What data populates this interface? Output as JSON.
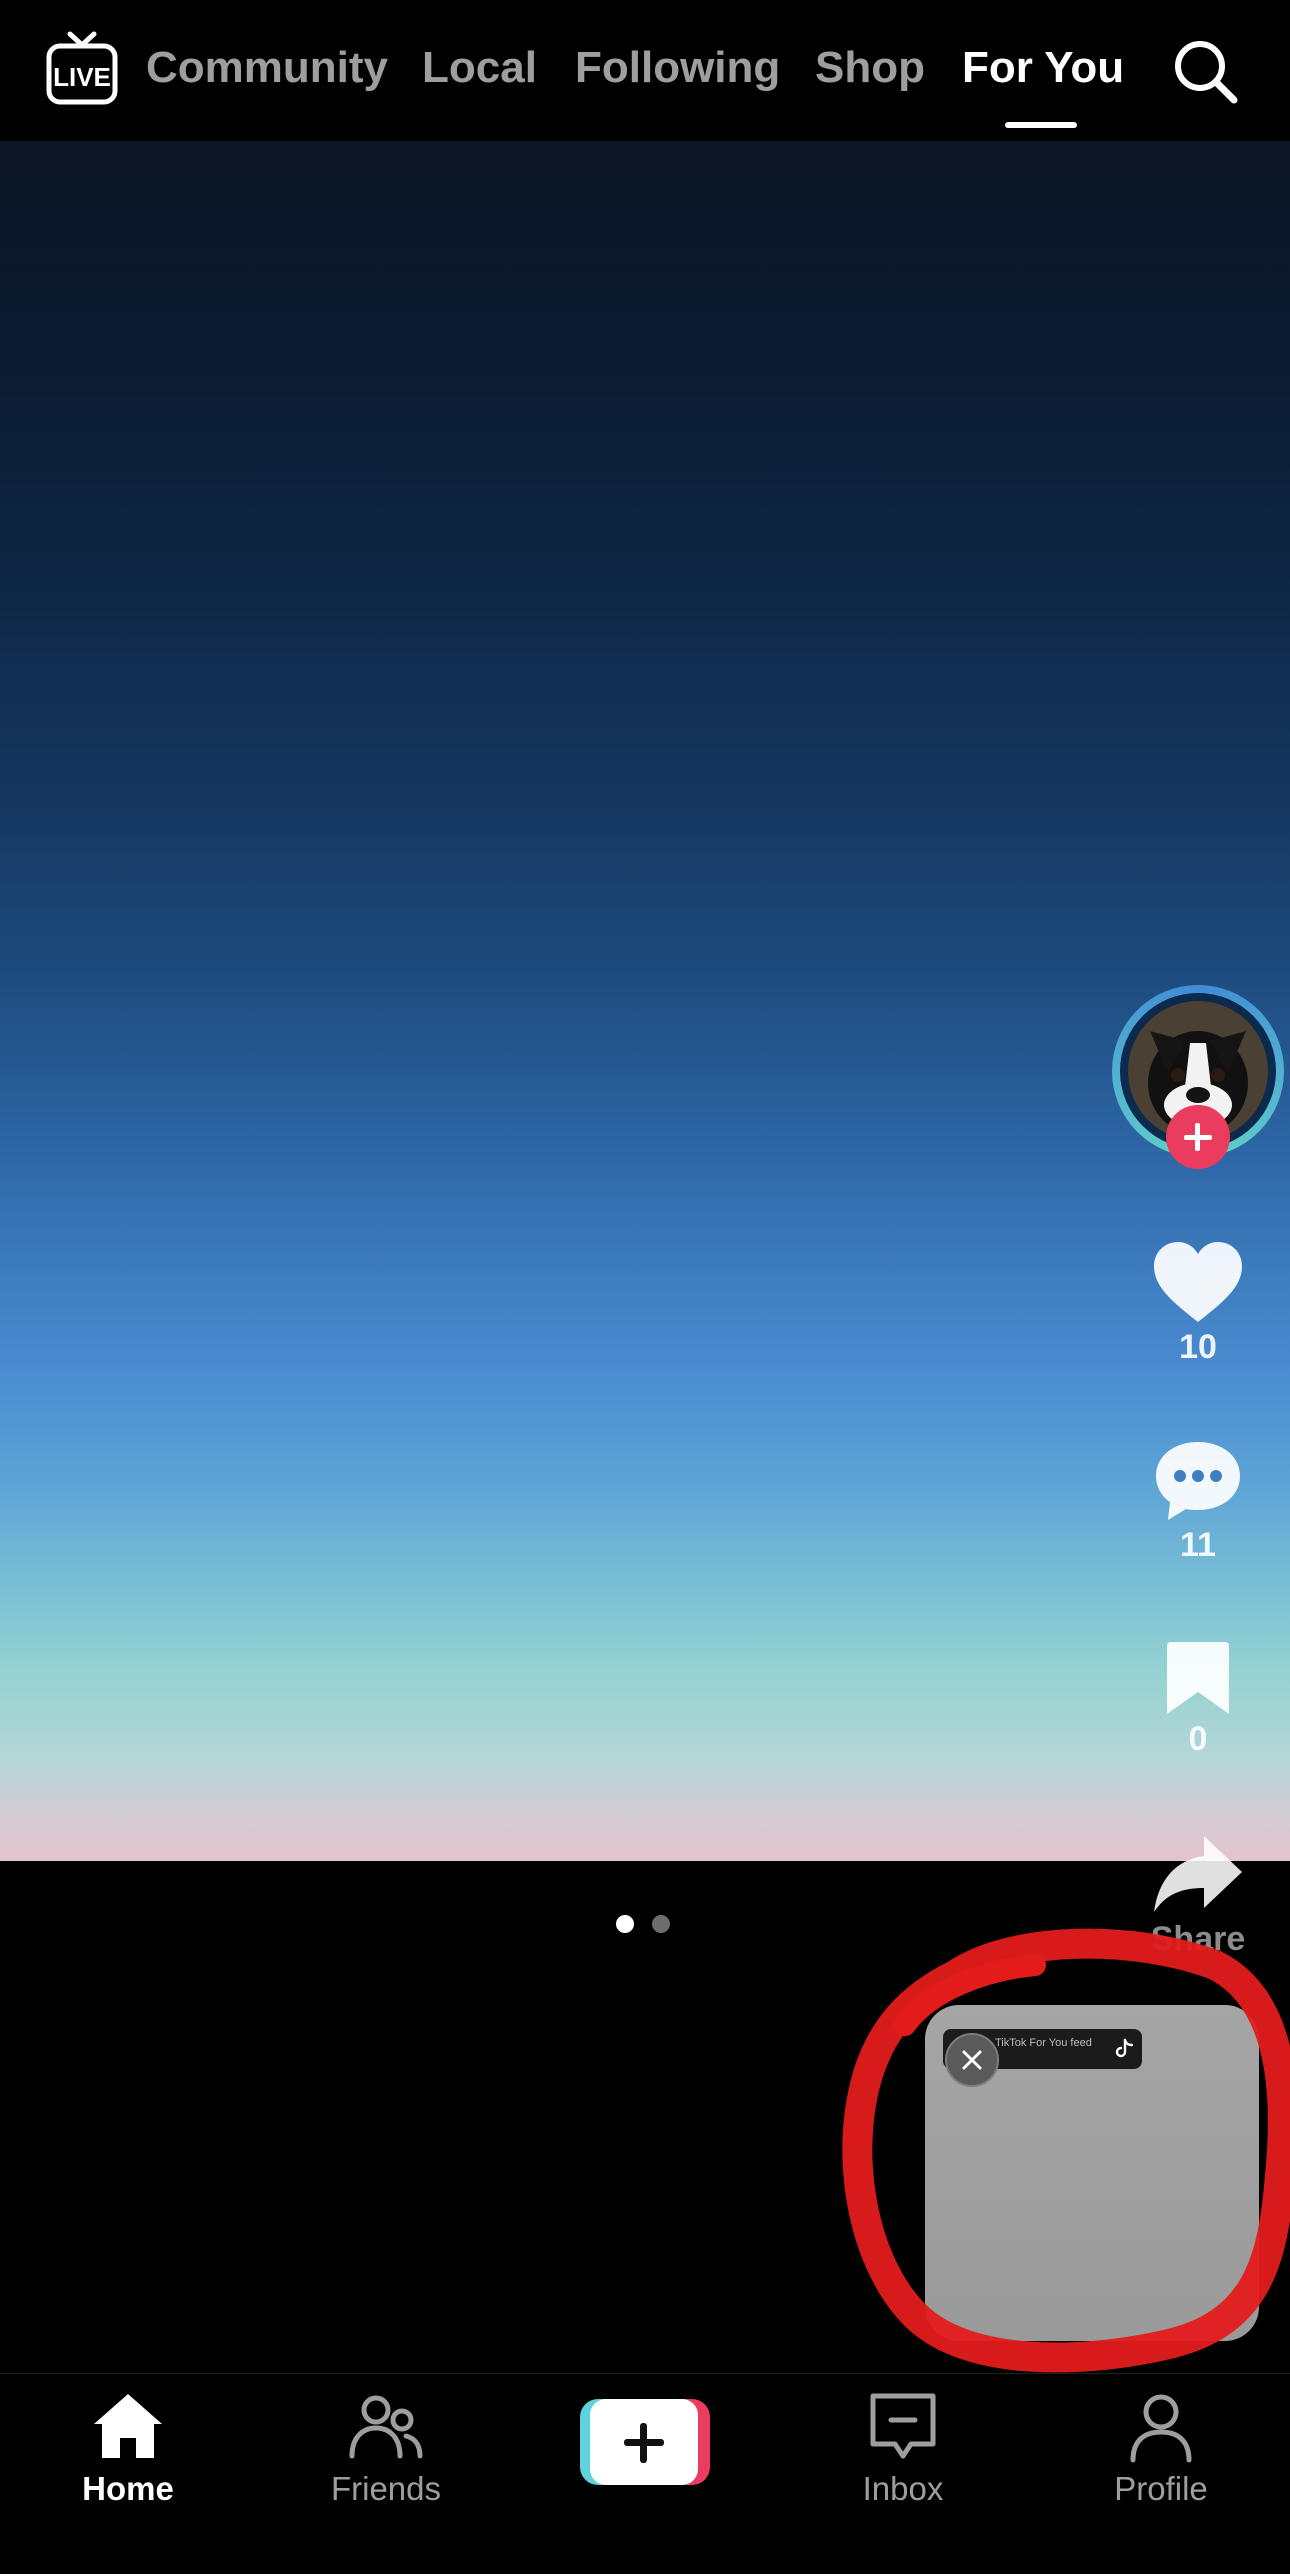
{
  "top_nav": {
    "live_icon": "live-tv-icon",
    "tabs": [
      {
        "label": "Community",
        "active": false
      },
      {
        "label": "Local",
        "active": false
      },
      {
        "label": "Following",
        "active": false
      },
      {
        "label": "Shop",
        "active": false
      },
      {
        "label": "For You",
        "active": true
      }
    ],
    "search_icon": "search-icon"
  },
  "video": {
    "page_indicator": {
      "count": 2,
      "current": 1
    }
  },
  "actions": {
    "avatar_icon": "creator-avatar-dog",
    "follow_icon": "plus-icon",
    "likes": "10",
    "comments": "11",
    "saves": "0",
    "share_label": "Share"
  },
  "pip": {
    "caption": "TikTok For You feed",
    "close_icon": "close-icon",
    "logo_icon": "tiktok-logo-icon",
    "annotation_color": "#e31b1b"
  },
  "bottom_nav": {
    "items": [
      {
        "label": "Home",
        "icon": "home-icon",
        "active": true
      },
      {
        "label": "Friends",
        "icon": "friends-icon",
        "active": false
      },
      {
        "label": "",
        "icon": "create-plus-icon",
        "active": false
      },
      {
        "label": "Inbox",
        "icon": "inbox-icon",
        "active": false
      },
      {
        "label": "Profile",
        "icon": "profile-icon",
        "active": false
      }
    ]
  },
  "colors": {
    "accent_red": "#ea3c5f",
    "accent_cyan": "#5fd3dd",
    "background": "#000000"
  }
}
